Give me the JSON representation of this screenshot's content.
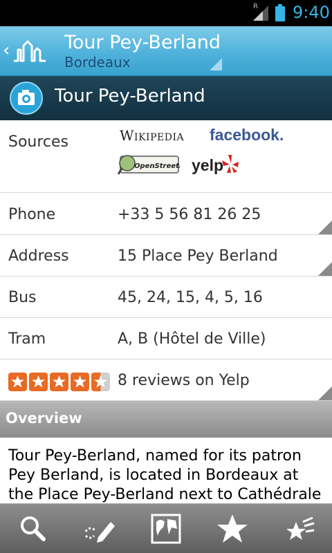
{
  "status_bar": {
    "time": "9:40",
    "signal_icon": "signal-bars-icon",
    "battery_icon": "battery-icon",
    "roaming_label": "R"
  },
  "action_bar": {
    "title": "Tour Pey-Berland",
    "subtitle": "Bordeaux",
    "back_icon": "back-chevron-icon",
    "logo_icon": "city-skyline-logo-icon"
  },
  "poi_header": {
    "icon": "camera-icon",
    "name": "Tour Pey-Berland"
  },
  "details": {
    "sources_label": "Sources",
    "sources": {
      "wikipedia": "Wikipedia",
      "facebook": "facebook.",
      "openstreetmap": "OpenStreetMap",
      "yelp": "yelp"
    },
    "phone": {
      "label": "Phone",
      "value": "+33 5 56 81 26 25"
    },
    "address": {
      "label": "Address",
      "value": "15 Place Pey Berland"
    },
    "bus": {
      "label": "Bus",
      "value": "45, 24, 15, 4, 5, 16"
    },
    "tram": {
      "label": "Tram",
      "value": "A, B (Hôtel de Ville)"
    },
    "rating": {
      "stars": 4.5,
      "max": 5,
      "value": "8 reviews on Yelp"
    }
  },
  "overview": {
    "heading": "Overview",
    "text": "Tour Pey-Berland, named for its patron Pey Berland, is located in Bordeaux at the Place Pey-Berland next to Cathédrale"
  },
  "bottom_bar": {
    "buttons": [
      "search-icon",
      "draw-route-icon",
      "map-icon",
      "favorites-star-icon",
      "nearby-stars-icon"
    ]
  },
  "colors": {
    "accent": "#33b5e5",
    "star": "#e86a24",
    "facebook": "#3b5998"
  }
}
